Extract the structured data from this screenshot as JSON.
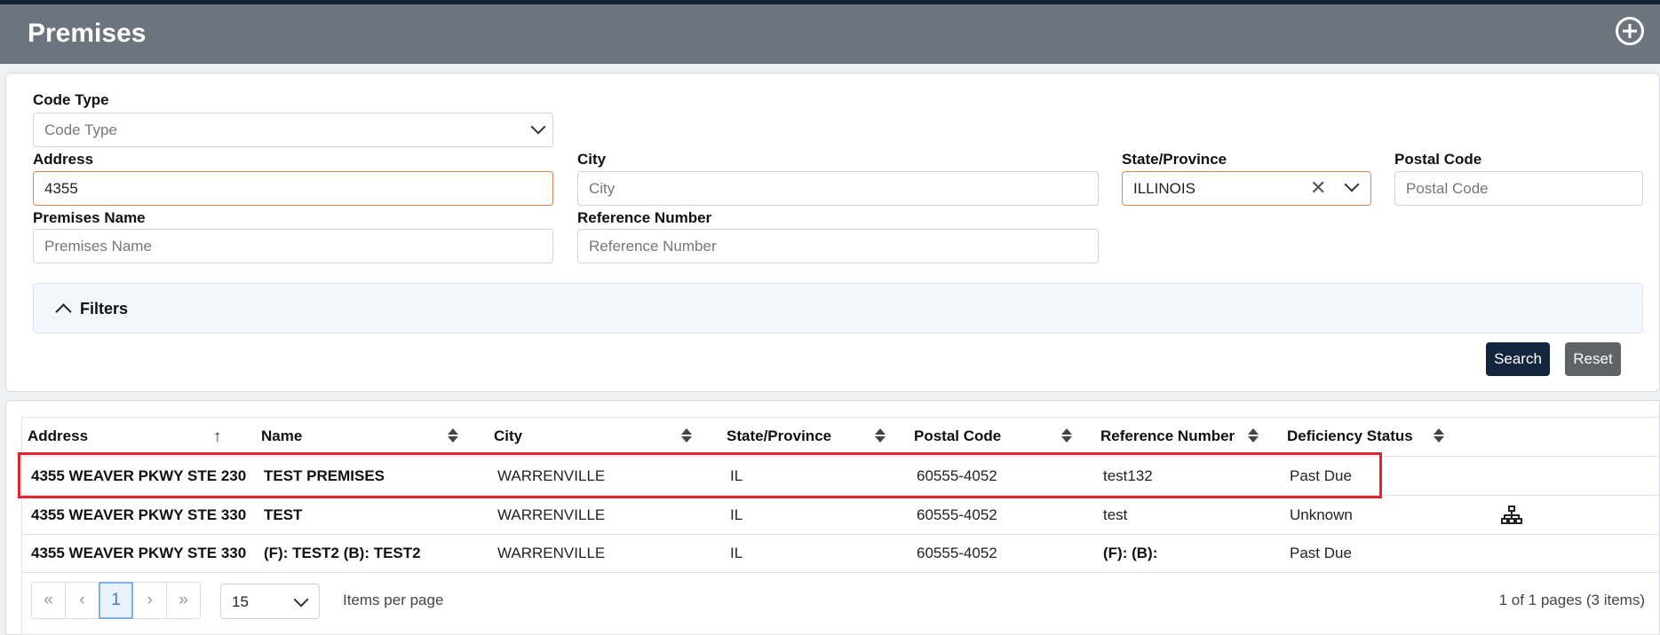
{
  "header": {
    "title": "Premises",
    "add_icon": "plus-circle-icon"
  },
  "form": {
    "code_type": {
      "label": "Code Type",
      "placeholder": "Code Type"
    },
    "address": {
      "label": "Address",
      "value": "4355"
    },
    "city": {
      "label": "City",
      "placeholder": "City"
    },
    "state": {
      "label": "State/Province",
      "value": "ILLINOIS"
    },
    "postal": {
      "label": "Postal Code",
      "placeholder": "Postal Code"
    },
    "premises_name": {
      "label": "Premises Name",
      "placeholder": "Premises Name"
    },
    "reference_number": {
      "label": "Reference Number",
      "placeholder": "Reference Number"
    }
  },
  "filters": {
    "label": "Filters"
  },
  "actions": {
    "search": "Search",
    "reset": "Reset"
  },
  "table": {
    "columns": [
      "Address",
      "Name",
      "City",
      "State/Province",
      "Postal Code",
      "Reference Number",
      "Deficiency Status"
    ],
    "rows": [
      {
        "address": "4355 WEAVER PKWY STE 230",
        "name": "TEST PREMISES",
        "city": "WARRENVILLE",
        "state": "IL",
        "postal": "60555-4052",
        "reference": "test132",
        "status": "Past Due"
      },
      {
        "address": "4355 WEAVER PKWY STE 330",
        "name": "TEST",
        "city": "WARRENVILLE",
        "state": "IL",
        "postal": "60555-4052",
        "reference": "test",
        "status": "Unknown"
      },
      {
        "address": "4355 WEAVER PKWY STE 330",
        "name": "(F): TEST2 (B): TEST2",
        "city": "WARRENVILLE",
        "state": "IL",
        "postal": "60555-4052",
        "reference": "(F): (B):",
        "status": "Past Due"
      }
    ]
  },
  "pager": {
    "first": "«",
    "prev": "‹",
    "current": "1",
    "next": "›",
    "last": "»",
    "page_size": "15",
    "items_per_page": "Items per page",
    "info": "1 of 1 pages (3 items)"
  },
  "colors": {
    "header_bg": "#6c747e",
    "primary": "#13263d",
    "highlight": "#e0252b",
    "input_focus": "#e0844c"
  }
}
